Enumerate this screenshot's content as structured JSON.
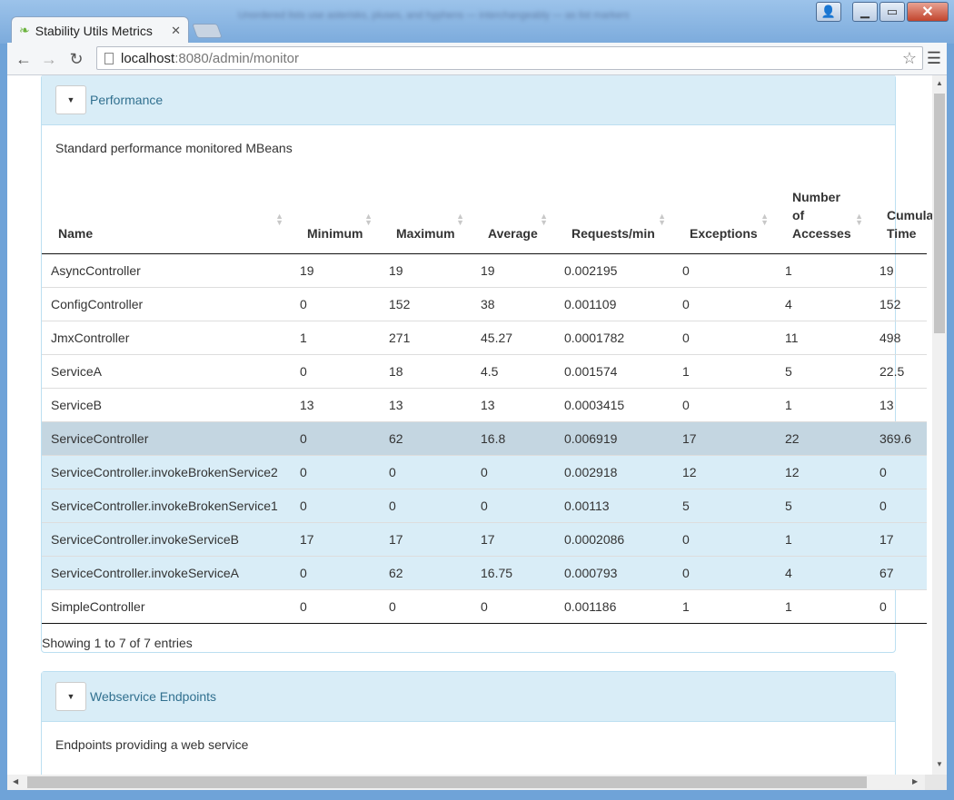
{
  "browser": {
    "tab_title": "Stability Utils Metrics",
    "tab_close": "✕",
    "blurred_title": "Unordered lists use asterisks, pluses, and hyphens — interchangeably — as list markers.",
    "url_host": "localhost",
    "url_path": ":8080/admin/monitor"
  },
  "panels": [
    {
      "title": "Performance",
      "description": "Standard performance monitored MBeans",
      "columns": [
        "Name",
        "Minimum",
        "Maximum",
        "Average",
        "Requests/min",
        "Exceptions",
        "Number of Accesses",
        "Cumulative Time"
      ],
      "rows": [
        {
          "cells": [
            "AsyncController",
            "19",
            "19",
            "19",
            "0.002195",
            "0",
            "1",
            "19"
          ],
          "style": ""
        },
        {
          "cells": [
            "ConfigController",
            "0",
            "152",
            "38",
            "0.001109",
            "0",
            "4",
            "152"
          ],
          "style": ""
        },
        {
          "cells": [
            "JmxController",
            "1",
            "271",
            "45.27",
            "0.0001782",
            "0",
            "11",
            "498"
          ],
          "style": ""
        },
        {
          "cells": [
            "ServiceA",
            "0",
            "18",
            "4.5",
            "0.001574",
            "1",
            "5",
            "22.5"
          ],
          "style": ""
        },
        {
          "cells": [
            "ServiceB",
            "13",
            "13",
            "13",
            "0.0003415",
            "0",
            "1",
            "13"
          ],
          "style": ""
        },
        {
          "cells": [
            "ServiceController",
            "0",
            "62",
            "16.8",
            "0.006919",
            "17",
            "22",
            "369.6"
          ],
          "style": "selected"
        },
        {
          "cells": [
            "ServiceController.invokeBrokenService2",
            "0",
            "0",
            "0",
            "0.002918",
            "12",
            "12",
            "0"
          ],
          "style": "highlight"
        },
        {
          "cells": [
            "ServiceController.invokeBrokenService1",
            "0",
            "0",
            "0",
            "0.00113",
            "5",
            "5",
            "0"
          ],
          "style": "highlight"
        },
        {
          "cells": [
            "ServiceController.invokeServiceB",
            "17",
            "17",
            "17",
            "0.0002086",
            "0",
            "1",
            "17"
          ],
          "style": "highlight"
        },
        {
          "cells": [
            "ServiceController.invokeServiceA",
            "0",
            "62",
            "16.75",
            "0.000793",
            "0",
            "4",
            "67"
          ],
          "style": "highlight"
        },
        {
          "cells": [
            "SimpleController",
            "0",
            "0",
            "0",
            "0.001186",
            "1",
            "1",
            "0"
          ],
          "style": ""
        }
      ],
      "footer": "Showing 1 to 7 of 7 entries"
    },
    {
      "title": "Webservice Endpoints",
      "description": "Endpoints providing a web service"
    }
  ]
}
